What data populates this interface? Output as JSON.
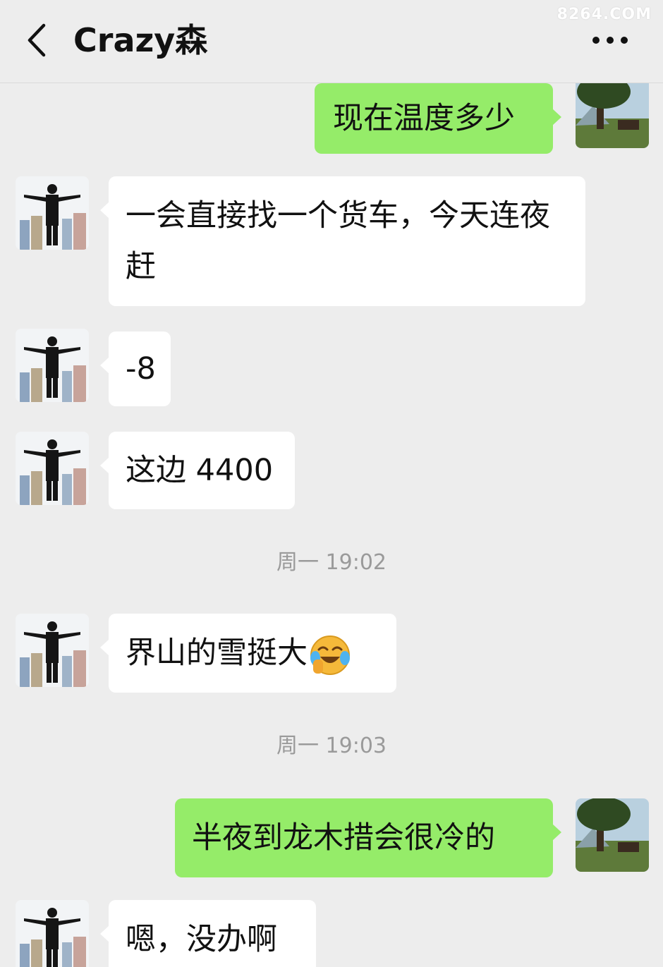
{
  "header": {
    "title": "Crazy森",
    "back_icon": "chevron-left-icon",
    "more_icon": "more-dots-icon",
    "watermark": "8264.COM"
  },
  "messages": [
    {
      "side": "out",
      "text": "现在温度多少"
    },
    {
      "side": "in",
      "text": "一会直接找一个货车，今天连夜赶"
    },
    {
      "side": "in",
      "text": "-8"
    },
    {
      "side": "in",
      "text": "这边 4400"
    },
    {
      "type": "time",
      "text": "周一 19:02"
    },
    {
      "side": "in",
      "text": "界山的雪挺大",
      "emoji": "face-with-tears-of-joy-icon"
    },
    {
      "type": "time",
      "text": "周一 19:03"
    },
    {
      "side": "out",
      "text": "半夜到龙木措会很冷的"
    },
    {
      "side": "in",
      "text": "嗯，没办啊"
    }
  ],
  "colors": {
    "background": "#ededed",
    "incoming_bubble": "#ffffff",
    "outgoing_bubble": "#95ec69",
    "timestamp": "#9a9a9a"
  }
}
